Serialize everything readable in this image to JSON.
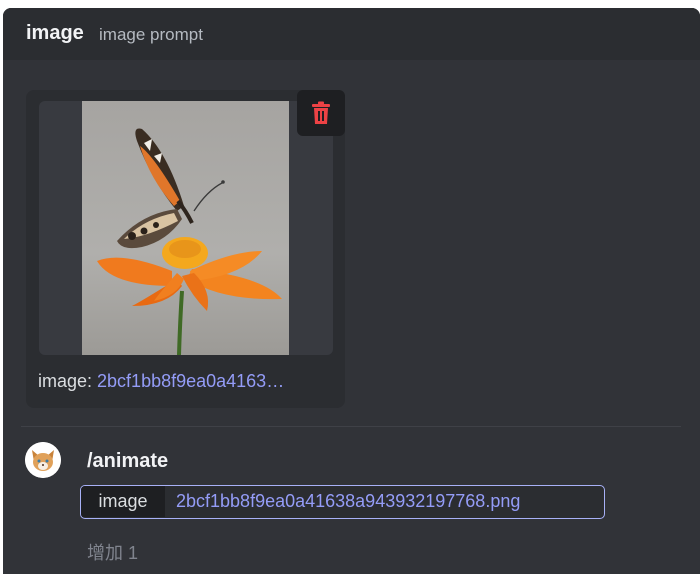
{
  "header": {
    "title": "image",
    "subtitle": "image prompt"
  },
  "attachment": {
    "caption_label": "image: ",
    "caption_value": "2bcf1bb8f9ea0a4163…",
    "delete_icon": "trash-icon"
  },
  "command": {
    "name": "/animate",
    "option_key": "image",
    "option_value": "2bcf1bb8f9ea0a41638a943932197768.png",
    "more_options": "增加 1"
  },
  "colors": {
    "background": "#313338",
    "header": "#2b2d31",
    "link": "#949cf7",
    "delete": "#ed4245",
    "pill_border": "#a8b1f7"
  }
}
